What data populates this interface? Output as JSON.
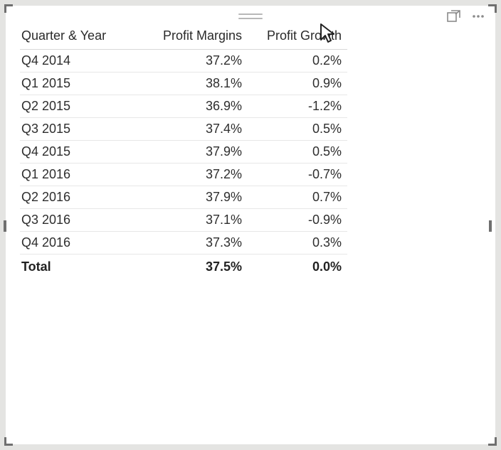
{
  "table": {
    "headers": [
      "Quarter & Year",
      "Profit Margins",
      "Profit Growth"
    ],
    "rows": [
      {
        "period": "Q4 2014",
        "margin": "37.2%",
        "growth": "0.2%"
      },
      {
        "period": "Q1 2015",
        "margin": "38.1%",
        "growth": "0.9%"
      },
      {
        "period": "Q2 2015",
        "margin": "36.9%",
        "growth": "-1.2%"
      },
      {
        "period": "Q3 2015",
        "margin": "37.4%",
        "growth": "0.5%"
      },
      {
        "period": "Q4 2015",
        "margin": "37.9%",
        "growth": "0.5%"
      },
      {
        "period": "Q1 2016",
        "margin": "37.2%",
        "growth": "-0.7%"
      },
      {
        "period": "Q2 2016",
        "margin": "37.9%",
        "growth": "0.7%"
      },
      {
        "period": "Q3 2016",
        "margin": "37.1%",
        "growth": "-0.9%"
      },
      {
        "period": "Q4 2016",
        "margin": "37.3%",
        "growth": "0.3%"
      }
    ],
    "total": {
      "label": "Total",
      "margin": "37.5%",
      "growth": "0.0%"
    }
  },
  "chart_data": {
    "type": "table",
    "title": "",
    "columns": [
      "Quarter & Year",
      "Profit Margins",
      "Profit Growth"
    ],
    "categories": [
      "Q4 2014",
      "Q1 2015",
      "Q2 2015",
      "Q3 2015",
      "Q4 2015",
      "Q1 2016",
      "Q2 2016",
      "Q3 2016",
      "Q4 2016"
    ],
    "series": [
      {
        "name": "Profit Margins",
        "unit": "%",
        "values": [
          37.2,
          38.1,
          36.9,
          37.4,
          37.9,
          37.2,
          37.9,
          37.1,
          37.3
        ]
      },
      {
        "name": "Profit Growth",
        "unit": "%",
        "values": [
          0.2,
          0.9,
          -1.2,
          0.5,
          0.5,
          -0.7,
          0.7,
          -0.9,
          0.3
        ]
      }
    ],
    "totals": {
      "Profit Margins": 37.5,
      "Profit Growth": 0.0
    }
  }
}
